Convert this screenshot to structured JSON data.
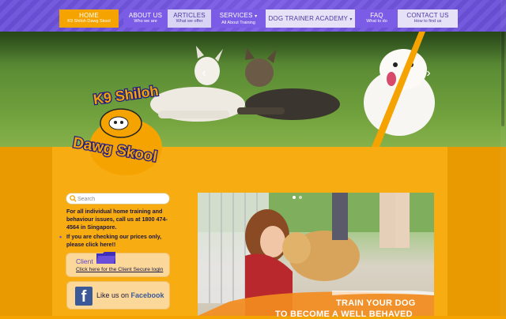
{
  "nav": {
    "items": [
      {
        "title": "HOME",
        "sub": "K9 Shiloh Dawg Skool"
      },
      {
        "title": "ABOUT US",
        "sub": "Who we are"
      },
      {
        "title": "ARTICLES",
        "sub": "What we offer"
      },
      {
        "title": "SERVICES",
        "sub": "All About Training"
      },
      {
        "title": "DOG TRAINER ACADEMY",
        "sub": ""
      },
      {
        "title": "FAQ",
        "sub": "What to do"
      },
      {
        "title": "CONTACT US",
        "sub": "How to find us"
      }
    ],
    "caret": "▾"
  },
  "logo": {
    "line1": "K9 Shiloh",
    "line2": "Dawg Skool"
  },
  "search": {
    "placeholder": "Search"
  },
  "info": {
    "text1": "For all individual home training and behaviour issues, call us at 1800 474-4564 in Singapore.",
    "text2": "If you are checking our prices only, please click here!!"
  },
  "client": {
    "label": "Client",
    "link": "Click here for the Client Secure login"
  },
  "facebook": {
    "glyph": "f",
    "prefix": "Like us on ",
    "brand": "Facebook"
  },
  "slider": {
    "caption1": "TRAIN YOUR DOG",
    "caption2": "TO BECOME A WELL BEHAVED",
    "prev": "‹",
    "next": "›"
  },
  "colors": {
    "brand_orange": "#f5a300",
    "brand_purple": "#6a4fd8",
    "facebook": "#3b5998"
  }
}
